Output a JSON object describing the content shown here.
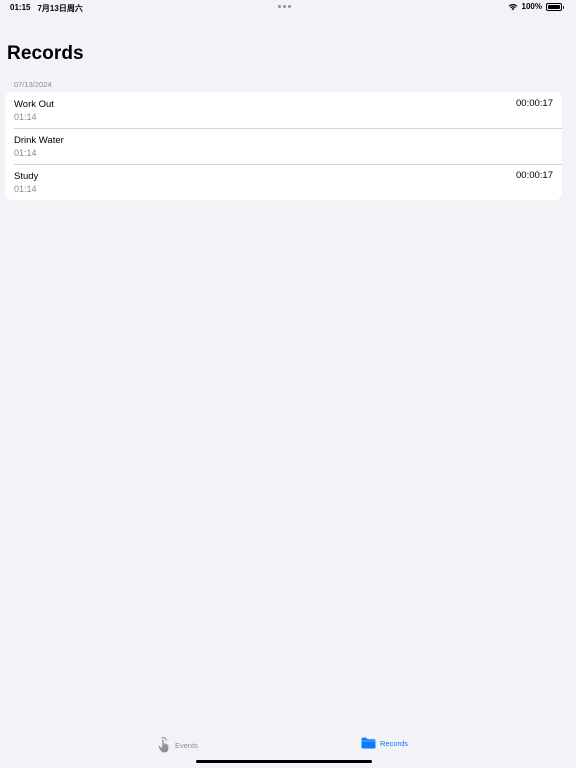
{
  "status_bar": {
    "time": "01:15",
    "date": "7月13日周六",
    "battery": "100%"
  },
  "page": {
    "title": "Records"
  },
  "section": {
    "header": "07/13/2024",
    "rows": [
      {
        "title": "Work Out",
        "time": "01:14",
        "duration": "00:00:17"
      },
      {
        "title": "Drink Water",
        "time": "01:14",
        "duration": ""
      },
      {
        "title": "Study",
        "time": "01:14",
        "duration": "00:00:17"
      }
    ]
  },
  "tab_bar": {
    "tabs": [
      {
        "label": "Events",
        "icon": "tap-hand-icon",
        "selected": false
      },
      {
        "label": "Records",
        "icon": "folder-icon",
        "selected": true
      }
    ],
    "accent_color": "#0a7aff",
    "inactive_color": "#8e8e93"
  }
}
